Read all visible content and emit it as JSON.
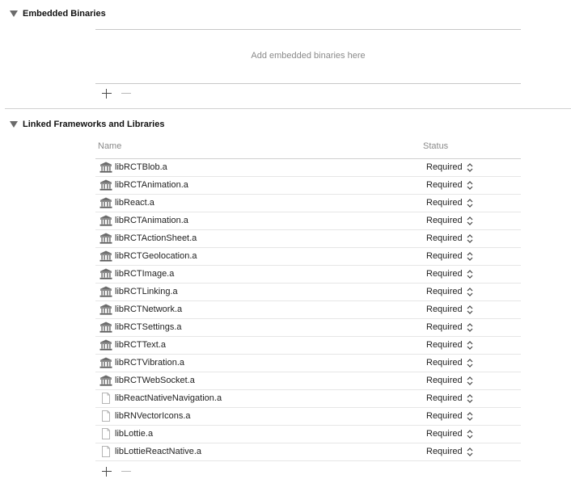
{
  "embedded": {
    "title": "Embedded Binaries",
    "empty_message": "Add embedded binaries here"
  },
  "linked": {
    "title": "Linked Frameworks and Libraries",
    "columns": {
      "name": "Name",
      "status": "Status"
    },
    "rows": [
      {
        "name": "libRCTBlob.a",
        "status": "Required",
        "icon": "library-icon"
      },
      {
        "name": "libRCTAnimation.a",
        "status": "Required",
        "icon": "library-icon"
      },
      {
        "name": "libReact.a",
        "status": "Required",
        "icon": "library-icon"
      },
      {
        "name": "libRCTAnimation.a",
        "status": "Required",
        "icon": "library-icon"
      },
      {
        "name": "libRCTActionSheet.a",
        "status": "Required",
        "icon": "library-icon"
      },
      {
        "name": "libRCTGeolocation.a",
        "status": "Required",
        "icon": "library-icon"
      },
      {
        "name": "libRCTImage.a",
        "status": "Required",
        "icon": "library-icon"
      },
      {
        "name": "libRCTLinking.a",
        "status": "Required",
        "icon": "library-icon"
      },
      {
        "name": "libRCTNetwork.a",
        "status": "Required",
        "icon": "library-icon"
      },
      {
        "name": "libRCTSettings.a",
        "status": "Required",
        "icon": "library-icon"
      },
      {
        "name": "libRCTText.a",
        "status": "Required",
        "icon": "library-icon"
      },
      {
        "name": "libRCTVibration.a",
        "status": "Required",
        "icon": "library-icon"
      },
      {
        "name": "libRCTWebSocket.a",
        "status": "Required",
        "icon": "library-icon"
      },
      {
        "name": "libReactNativeNavigation.a",
        "status": "Required",
        "icon": "file-icon"
      },
      {
        "name": "libRNVectorIcons.a",
        "status": "Required",
        "icon": "file-icon"
      },
      {
        "name": "libLottie.a",
        "status": "Required",
        "icon": "file-icon"
      },
      {
        "name": "libLottieReactNative.a",
        "status": "Required",
        "icon": "file-icon"
      }
    ]
  }
}
